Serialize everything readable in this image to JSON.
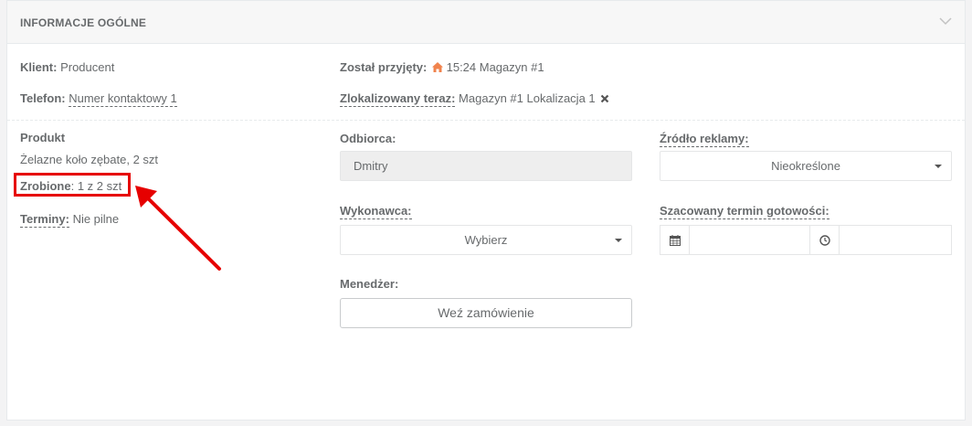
{
  "panel": {
    "title": "INFORMACJE OGÓLNE"
  },
  "top_info": {
    "client_label": "Klient:",
    "client_value": "Producent",
    "phone_label": "Telefon:",
    "phone_value": "Numer kontaktowy 1",
    "received_label": "Został przyjęty:",
    "received_value": "15:24 Magazyn #1",
    "located_label": "Zlokalizowany teraz:",
    "located_value": "Magazyn #1 Lokalizacja 1"
  },
  "product": {
    "label": "Produkt",
    "name": "Żelazne koło zębate, 2 szt",
    "done_label": "Zrobione",
    "done_value": ": 1 z 2 szt",
    "terms_label": "Terminy:",
    "terms_value": "Nie pilne"
  },
  "form": {
    "recipient_label": "Odbiorca:",
    "recipient_value": "Dmitry",
    "source_label": "Źródło reklamy:",
    "source_value": "Nieokreślone",
    "contractor_label": "Wykonawca:",
    "contractor_value": "Wybierz",
    "deadline_label": "Szacowany termin gotowości:",
    "manager_label": "Menedżer:",
    "manager_button": "Weź zamówienie"
  },
  "colors": {
    "highlight": "#e60000",
    "home_icon": "#f0834d"
  },
  "icons": [
    "chevron-down-icon",
    "home-icon",
    "close-icon",
    "calendar-icon",
    "clock-icon",
    "caret-down-icon"
  ]
}
